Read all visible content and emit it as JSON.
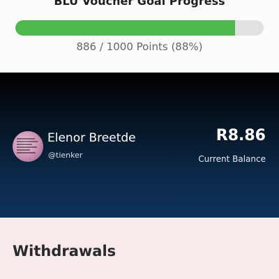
{
  "goal": {
    "title": "BLU Voucher Goal Progress",
    "progress_text": "886 / 1000 Points (88%)",
    "progress_fraction": 0.886,
    "bar_color": "#4cb94a",
    "track_color": "#e2e2e2"
  },
  "profile": {
    "name": "Elenor Breetde",
    "handle": "@tienker",
    "balance": "R8.86",
    "balance_label": "Current Balance"
  },
  "withdrawals": {
    "title": "Withdrawals"
  }
}
